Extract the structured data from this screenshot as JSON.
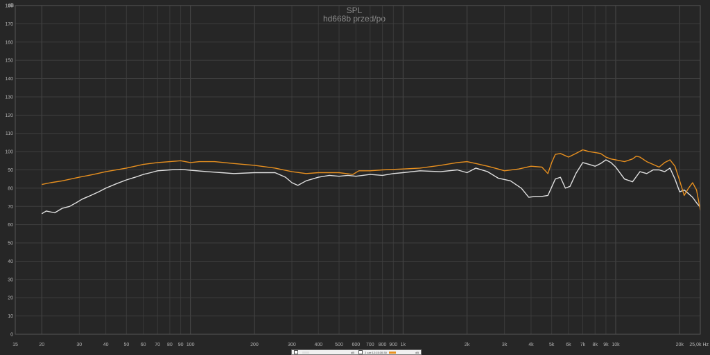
{
  "chart_data": {
    "type": "line",
    "title": "SPL",
    "subtitle": "hd668b przed/po",
    "ylabel": "dB",
    "xunit": "Hz",
    "xscale": "log",
    "xlim": [
      15,
      25000
    ],
    "ylim": [
      0,
      180
    ],
    "grid": true,
    "x_tick_labels": [
      {
        "v": 15,
        "t": "15"
      },
      {
        "v": 20,
        "t": "20"
      },
      {
        "v": 30,
        "t": "30"
      },
      {
        "v": 40,
        "t": "40"
      },
      {
        "v": 50,
        "t": "50"
      },
      {
        "v": 60,
        "t": "60"
      },
      {
        "v": 70,
        "t": "70"
      },
      {
        "v": 80,
        "t": "80"
      },
      {
        "v": 90,
        "t": "90"
      },
      {
        "v": 100,
        "t": "100"
      },
      {
        "v": 200,
        "t": "200"
      },
      {
        "v": 300,
        "t": "300"
      },
      {
        "v": 400,
        "t": "400"
      },
      {
        "v": 500,
        "t": "500"
      },
      {
        "v": 600,
        "t": "600"
      },
      {
        "v": 700,
        "t": "700"
      },
      {
        "v": 800,
        "t": "800"
      },
      {
        "v": 900,
        "t": "900"
      },
      {
        "v": 1000,
        "t": "1k"
      },
      {
        "v": 2000,
        "t": "2k"
      },
      {
        "v": 3000,
        "t": "3k"
      },
      {
        "v": 4000,
        "t": "4k"
      },
      {
        "v": 5000,
        "t": "5k"
      },
      {
        "v": 6000,
        "t": "6k"
      },
      {
        "v": 7000,
        "t": "7k"
      },
      {
        "v": 8000,
        "t": "8k"
      },
      {
        "v": 9000,
        "t": "9k"
      },
      {
        "v": 10000,
        "t": "10k"
      },
      {
        "v": 20000,
        "t": "20k"
      },
      {
        "v": 25000,
        "t": "25,0k Hz"
      }
    ],
    "y_ticks": [
      0,
      10,
      20,
      30,
      40,
      50,
      60,
      70,
      80,
      90,
      100,
      110,
      120,
      130,
      140,
      150,
      160,
      170,
      180
    ],
    "series": [
      {
        "name": "",
        "color": "#e0e0e0",
        "points": [
          [
            20,
            66
          ],
          [
            21,
            67.5
          ],
          [
            23,
            66.5
          ],
          [
            25,
            69
          ],
          [
            27,
            70
          ],
          [
            29,
            72
          ],
          [
            31,
            74
          ],
          [
            34,
            76
          ],
          [
            37,
            78
          ],
          [
            40,
            80
          ],
          [
            45,
            82.5
          ],
          [
            50,
            84.5
          ],
          [
            55,
            86
          ],
          [
            60,
            87.5
          ],
          [
            65,
            88.5
          ],
          [
            70,
            89.5
          ],
          [
            80,
            90
          ],
          [
            90,
            90.3
          ],
          [
            100,
            89.8
          ],
          [
            120,
            89
          ],
          [
            140,
            88.5
          ],
          [
            160,
            88
          ],
          [
            200,
            88.5
          ],
          [
            250,
            88.5
          ],
          [
            280,
            86
          ],
          [
            300,
            83
          ],
          [
            320,
            81.5
          ],
          [
            350,
            84
          ],
          [
            400,
            86
          ],
          [
            450,
            87
          ],
          [
            500,
            86.5
          ],
          [
            550,
            87
          ],
          [
            600,
            86.5
          ],
          [
            700,
            87.5
          ],
          [
            800,
            87
          ],
          [
            900,
            88
          ],
          [
            1000,
            88.5
          ],
          [
            1200,
            89.5
          ],
          [
            1500,
            89
          ],
          [
            1800,
            90
          ],
          [
            2000,
            88.5
          ],
          [
            2200,
            91
          ],
          [
            2500,
            89
          ],
          [
            2800,
            85.5
          ],
          [
            3200,
            84
          ],
          [
            3600,
            80
          ],
          [
            3900,
            75
          ],
          [
            4200,
            75.5
          ],
          [
            4500,
            75.5
          ],
          [
            4800,
            76
          ],
          [
            5200,
            85
          ],
          [
            5500,
            86
          ],
          [
            5800,
            80
          ],
          [
            6100,
            81
          ],
          [
            6500,
            88
          ],
          [
            7000,
            94
          ],
          [
            7500,
            93
          ],
          [
            8000,
            92
          ],
          [
            8500,
            93.5
          ],
          [
            9000,
            95.5
          ],
          [
            9500,
            94
          ],
          [
            10000,
            91.5
          ],
          [
            11000,
            85
          ],
          [
            12000,
            83.5
          ],
          [
            13000,
            89
          ],
          [
            14000,
            88
          ],
          [
            15000,
            90
          ],
          [
            16000,
            90
          ],
          [
            17000,
            89
          ],
          [
            18000,
            91
          ],
          [
            19000,
            85
          ],
          [
            20000,
            78
          ],
          [
            21000,
            79
          ],
          [
            22000,
            77
          ],
          [
            23000,
            75
          ],
          [
            24000,
            72
          ],
          [
            25000,
            69.5
          ]
        ]
      },
      {
        "name": "",
        "color": "#e8901f",
        "points": [
          [
            20,
            82
          ],
          [
            22,
            83
          ],
          [
            25,
            84
          ],
          [
            30,
            86
          ],
          [
            35,
            87.5
          ],
          [
            40,
            89
          ],
          [
            50,
            91
          ],
          [
            60,
            93
          ],
          [
            70,
            94
          ],
          [
            80,
            94.5
          ],
          [
            90,
            95
          ],
          [
            100,
            94
          ],
          [
            110,
            94.5
          ],
          [
            130,
            94.5
          ],
          [
            160,
            93.5
          ],
          [
            200,
            92.5
          ],
          [
            250,
            91
          ],
          [
            300,
            89
          ],
          [
            350,
            88
          ],
          [
            400,
            88.5
          ],
          [
            500,
            88.5
          ],
          [
            580,
            87.5
          ],
          [
            620,
            89.5
          ],
          [
            700,
            89.5
          ],
          [
            800,
            90
          ],
          [
            1000,
            90.5
          ],
          [
            1200,
            91
          ],
          [
            1500,
            92.5
          ],
          [
            1800,
            94
          ],
          [
            2000,
            94.5
          ],
          [
            2200,
            93.5
          ],
          [
            2500,
            92
          ],
          [
            2800,
            90.5
          ],
          [
            3000,
            89.5
          ],
          [
            3500,
            90.5
          ],
          [
            4000,
            92
          ],
          [
            4500,
            91.5
          ],
          [
            4800,
            88
          ],
          [
            5000,
            94
          ],
          [
            5200,
            98.5
          ],
          [
            5500,
            99
          ],
          [
            6000,
            97
          ],
          [
            6500,
            99
          ],
          [
            7000,
            101
          ],
          [
            7500,
            100
          ],
          [
            8000,
            99.5
          ],
          [
            8500,
            99
          ],
          [
            9000,
            97
          ],
          [
            9500,
            96
          ],
          [
            10000,
            95.5
          ],
          [
            11000,
            94.5
          ],
          [
            12000,
            96
          ],
          [
            12500,
            97.5
          ],
          [
            13000,
            97
          ],
          [
            14000,
            94.5
          ],
          [
            15000,
            93
          ],
          [
            16000,
            91.5
          ],
          [
            17000,
            94
          ],
          [
            18000,
            95.5
          ],
          [
            19000,
            92
          ],
          [
            20000,
            84
          ],
          [
            21000,
            76
          ],
          [
            22000,
            80
          ],
          [
            23000,
            83
          ],
          [
            24000,
            79
          ],
          [
            25000,
            68
          ]
        ]
      }
    ],
    "legend": {
      "items": [
        {
          "label": "",
          "color": "#e0e0e0",
          "extra": "dB"
        },
        {
          "label": "2 cze 12:15:30:30",
          "color": "#e8901f",
          "extra": "dB"
        }
      ]
    }
  }
}
